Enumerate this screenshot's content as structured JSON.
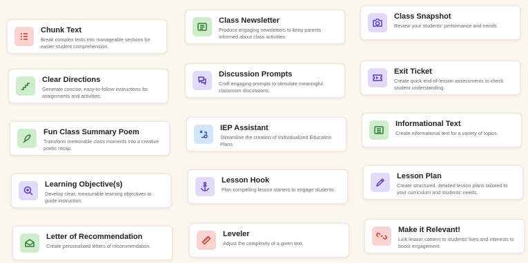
{
  "tools": [
    {
      "title": "Chunk Text",
      "desc": "Break complex texts into manageable sections for easier student comprehension.",
      "icon": "list-icon",
      "color": "#f9d3cf"
    },
    {
      "title": "Class Newsletter",
      "desc": "Produce engaging newsletters to keep parents informed about class activities.",
      "icon": "newsletter-icon",
      "color": "#cfeccd"
    },
    {
      "title": "Class Snapshot",
      "desc": "Review your students' performance and trends.",
      "icon": "camera-icon",
      "color": "#e3d9fb"
    },
    {
      "title": "Clear Directions",
      "desc": "Generate concise, easy-to-follow instructions for assignments and activities.",
      "icon": "stairs-icon",
      "color": "#cfeccd"
    },
    {
      "title": "Discussion Prompts",
      "desc": "Craft engaging prompts to stimulate meaningful classroom discussions.",
      "icon": "chat-bubbles-icon",
      "color": "#e3d9fb"
    },
    {
      "title": "Exit Ticket",
      "desc": "Create quick end-of-lesson assessments to check student understanding.",
      "icon": "ticket-icon",
      "color": "#e3d9fb"
    },
    {
      "title": "Fun Class Summary Poem",
      "desc": "Transform memorable class moments into a creative poetic recap.",
      "icon": "feather-icon",
      "color": "#cfeccd"
    },
    {
      "title": "IEP Assistant",
      "desc": "Streamline the creation of Individualized Education Plans.",
      "icon": "strategy-icon",
      "color": "#d3e4fb"
    },
    {
      "title": "Informational Text",
      "desc": "Create informational text for a variety of topics.",
      "icon": "document-icon",
      "color": "#cfeccd"
    },
    {
      "title": "Learning Objective(s)",
      "desc": "Develop clear, measurable learning objectives to guide instruction.",
      "icon": "magnifier-icon",
      "color": "#e3d9fb"
    },
    {
      "title": "Lesson Hook",
      "desc": "Plan compelling lesson starters to engage students.",
      "icon": "anchor-icon",
      "color": "#e3d9fb"
    },
    {
      "title": "Lesson Plan",
      "desc": "Create structured, detailed lesson plans tailored to your curriculum and students' needs.",
      "icon": "pencil-icon",
      "color": "#e3d9fb"
    },
    {
      "title": "Letter of Recommendation",
      "desc": "Create personalized letters of recommendation.",
      "icon": "envelope-icon",
      "color": "#cfeccd"
    },
    {
      "title": "Leveler",
      "desc": "Adjust the complexity of a given text.",
      "icon": "ruler-icon",
      "color": "#f9d3cf"
    },
    {
      "title": "Make it Relevant!",
      "desc": "Link lesson content to students' lives and interests to boost engagement.",
      "icon": "link-icon",
      "color": "#f9d3cf"
    }
  ]
}
